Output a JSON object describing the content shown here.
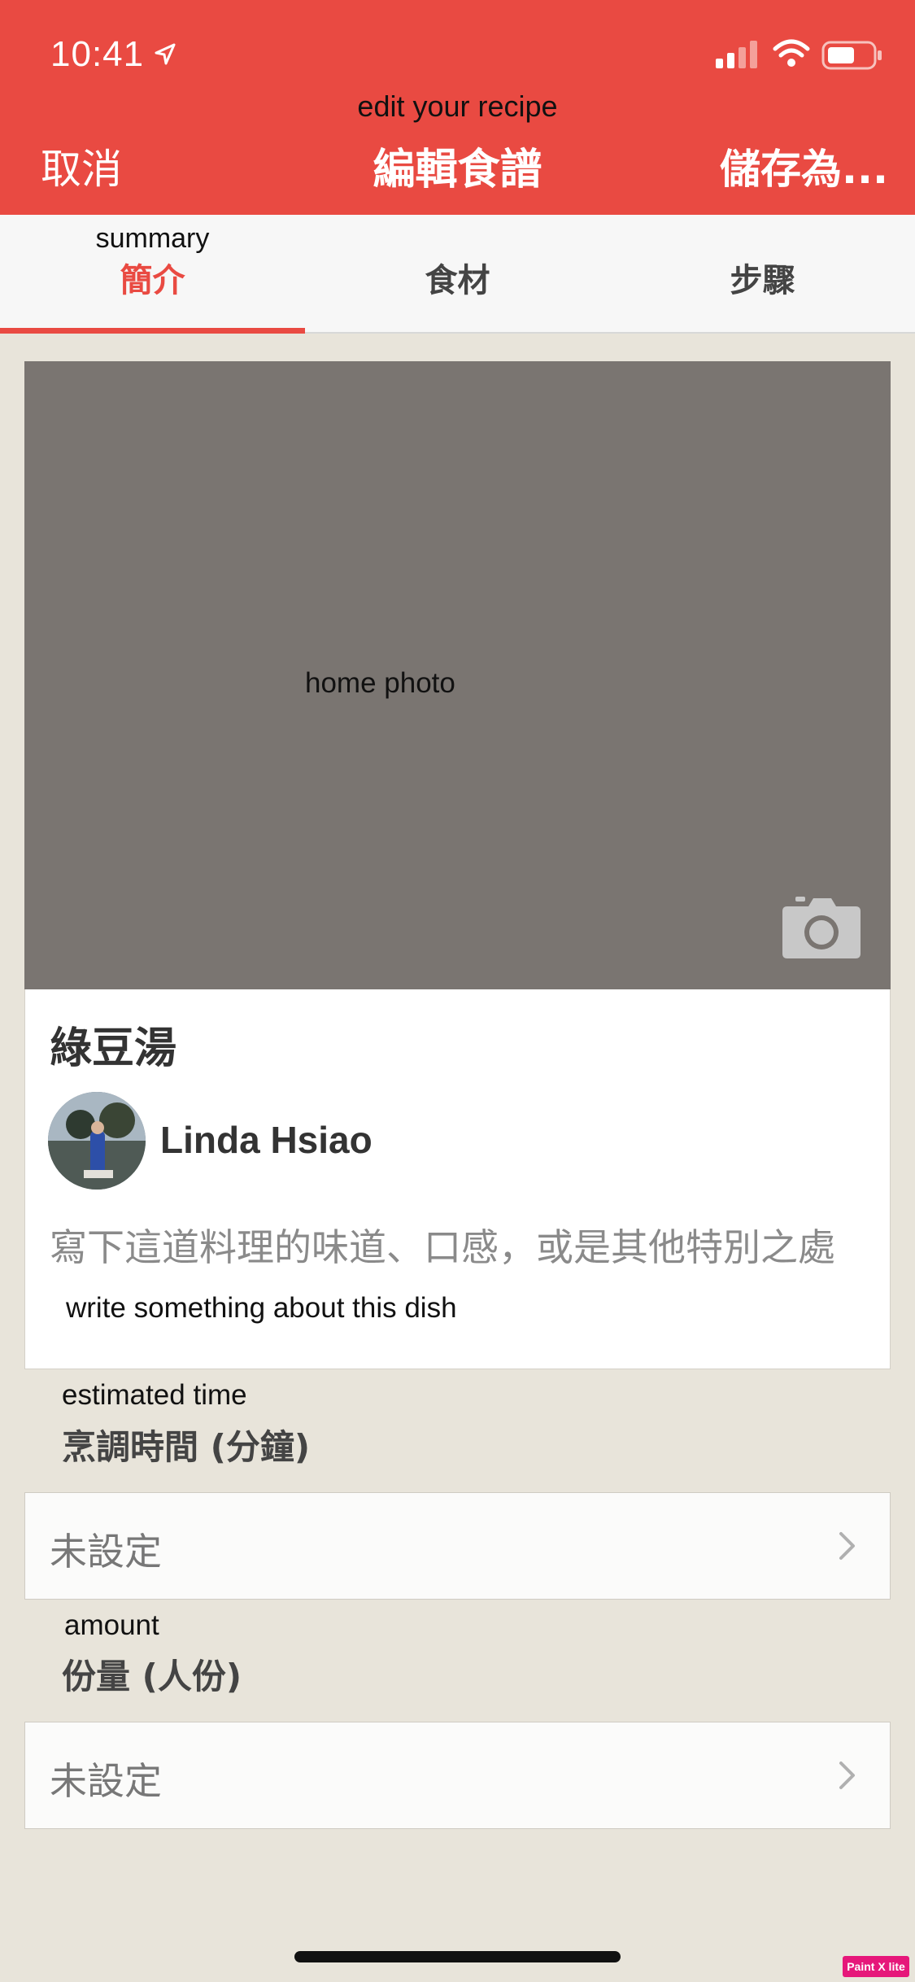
{
  "status_bar": {
    "time": "10:41"
  },
  "header": {
    "subtitle": "edit your recipe",
    "cancel_label": "取消",
    "title": "編輯食譜",
    "save_label": "儲存為..."
  },
  "tabs": [
    {
      "label": "簡介",
      "sub": "summary",
      "active": true
    },
    {
      "label": "食材",
      "sub": "",
      "active": false
    },
    {
      "label": "步驟",
      "sub": "",
      "active": false
    }
  ],
  "photo": {
    "label": "home photo",
    "icon": "camera-icon"
  },
  "recipe": {
    "name": "綠豆湯",
    "author": "Linda Hsiao",
    "description_placeholder": "寫下這道料理的味道、口感，或是其他特別之處",
    "description_hint": "write something about this dish"
  },
  "fields": {
    "time": {
      "sub": "estimated time",
      "label": "烹調時間 (分鐘)",
      "value": "未設定"
    },
    "amount": {
      "sub": "amount",
      "label": "份量 (人份)",
      "value": "未設定"
    }
  },
  "watermark": "Paint X lite",
  "colors": {
    "accent": "#e94a42",
    "background": "#e8e4da",
    "photo_bg": "#7a7571"
  }
}
